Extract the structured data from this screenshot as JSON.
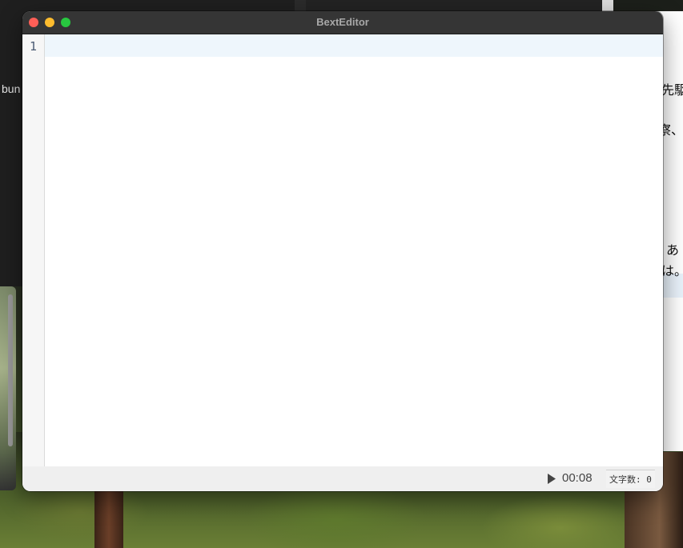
{
  "window": {
    "title": "BextEditor"
  },
  "editor": {
    "line_numbers": [
      "1"
    ],
    "content": ""
  },
  "statusbar": {
    "timer": "00:08",
    "char_count_label": "文字数: 0"
  },
  "background": {
    "left_window_text": "bun",
    "right_window_lines": [
      "先駆",
      "察、",
      "あ",
      "は。"
    ]
  },
  "colors": {
    "titlebar": "#353535",
    "current_line_highlight": "#eef6fc",
    "close": "#ff5f57",
    "minimize": "#febc2e",
    "maximize": "#28c840"
  },
  "icons": {
    "play": "play-triangle-icon"
  }
}
